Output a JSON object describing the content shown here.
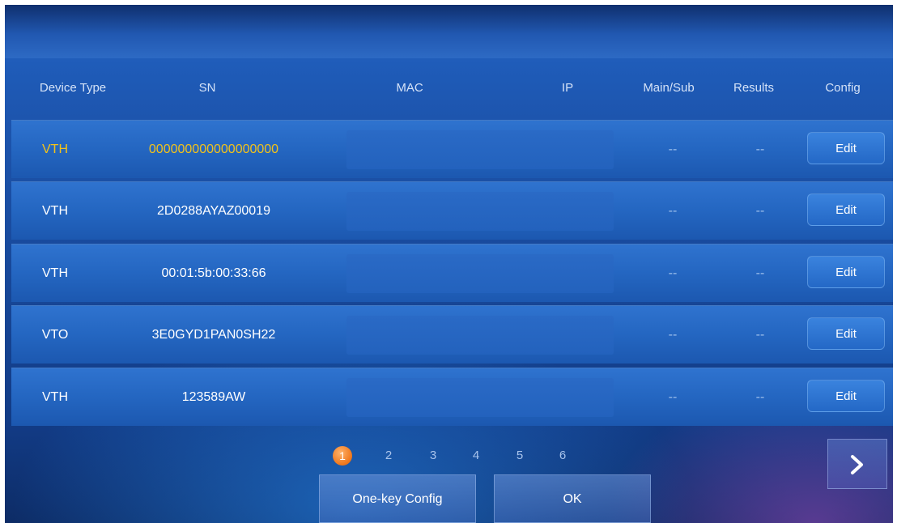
{
  "headers": {
    "device_type": "Device Type",
    "sn": "SN",
    "mac": "MAC",
    "ip": "IP",
    "main_sub": "Main/Sub",
    "results": "Results",
    "config": "Config"
  },
  "rows": [
    {
      "device_type": "VTH",
      "sn": "000000000000000000",
      "main_sub": "--",
      "results": "--",
      "edit": "Edit",
      "highlighted": true
    },
    {
      "device_type": "VTH",
      "sn": "2D0288AYAZ00019",
      "main_sub": "--",
      "results": "--",
      "edit": "Edit",
      "highlighted": false
    },
    {
      "device_type": "VTH",
      "sn": "00:01:5b:00:33:66",
      "main_sub": "--",
      "results": "--",
      "edit": "Edit",
      "highlighted": false
    },
    {
      "device_type": "VTO",
      "sn": "3E0GYD1PAN0SH22",
      "main_sub": "--",
      "results": "--",
      "edit": "Edit",
      "highlighted": false
    },
    {
      "device_type": "VTH",
      "sn": "123589AW",
      "main_sub": "--",
      "results": "--",
      "edit": "Edit",
      "highlighted": false
    }
  ],
  "pagination": {
    "pages": [
      "1",
      "2",
      "3",
      "4",
      "5",
      "6"
    ],
    "current": "1"
  },
  "buttons": {
    "one_key_config": "One-key Config",
    "ok": "OK",
    "next_icon": "chevron-right-icon"
  },
  "colors": {
    "highlight_text": "#f2c21a",
    "active_page": "#f07a1f",
    "row_bg": "#2466c1"
  }
}
